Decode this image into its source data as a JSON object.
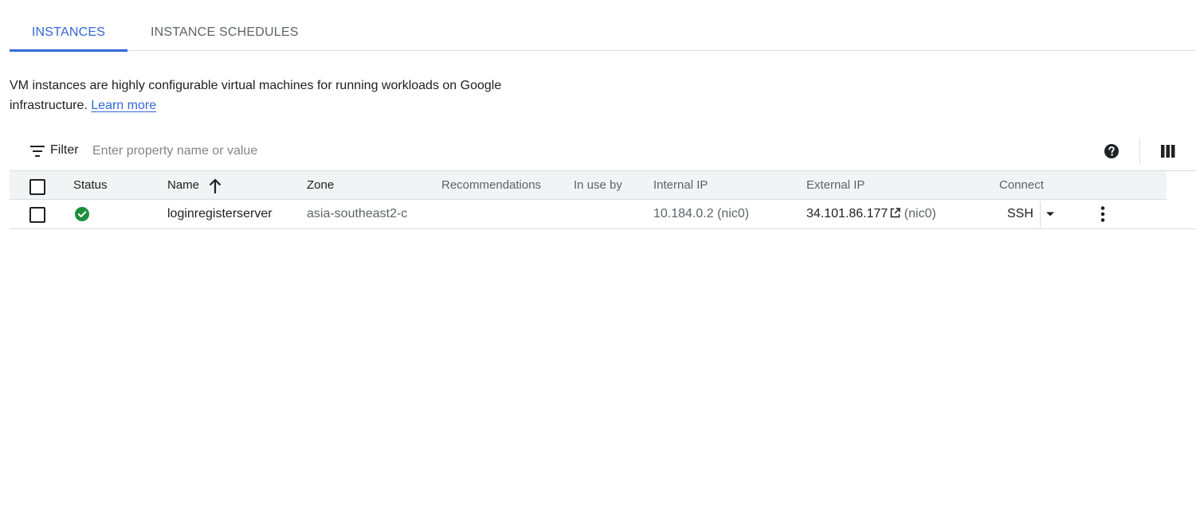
{
  "tabs": [
    {
      "label": "INSTANCES",
      "active": true
    },
    {
      "label": "INSTANCE SCHEDULES",
      "active": false
    }
  ],
  "description": {
    "text": "VM instances are highly configurable virtual machines for running workloads on Google infrastructure.",
    "link": "Learn more"
  },
  "filter": {
    "label": "Filter",
    "placeholder": "Enter property name or value",
    "icon": "filter-icon",
    "help_icon": "help-icon",
    "columns_icon": "column-display-icon"
  },
  "table": {
    "headers": {
      "status": "Status",
      "name": "Name",
      "zone": "Zone",
      "recommendations": "Recommendations",
      "in_use_by": "In use by",
      "internal_ip": "Internal IP",
      "external_ip": "External IP",
      "connect": "Connect"
    },
    "sort": {
      "column": "Name",
      "direction": "ascending"
    },
    "rows": [
      {
        "status": "running",
        "name": "loginregisterserver",
        "zone": "asia-southeast2-c",
        "recommendations": "",
        "in_use_by": "",
        "internal_ip": "10.184.0.2",
        "internal_nic": "(nic0)",
        "external_ip": "34.101.86.177",
        "external_nic": "(nic0)",
        "connect": "SSH"
      }
    ]
  },
  "colors": {
    "accent": "#3367d6",
    "status_running": "#1e8e3e",
    "header_bg": "#f1f3f4",
    "border": "#dadce0",
    "muted_text": "#5f6368"
  }
}
